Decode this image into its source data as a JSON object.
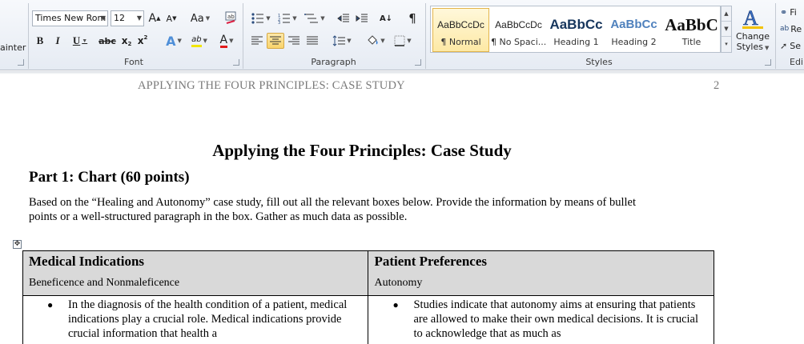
{
  "ribbon": {
    "clipboard": {
      "partial_label": "ainter"
    },
    "font": {
      "font_name": "Times New Rom",
      "font_size": "12",
      "grow_glyph": "A",
      "shrink_glyph": "A",
      "change_case_glyph": "Aa",
      "bold": "B",
      "italic": "I",
      "underline": "U",
      "strikethrough": "abc",
      "subscript": "x",
      "superscript": "x",
      "text_effects": "A",
      "highlight": "ab",
      "font_color": "A",
      "group_label": "Font"
    },
    "paragraph": {
      "show_marks": "¶",
      "sort": "A↓",
      "group_label": "Paragraph"
    },
    "styles": {
      "tiles": [
        {
          "sample": "AaBbCcDc",
          "name": "¶ Normal"
        },
        {
          "sample": "AaBbCcDc",
          "name": "¶ No Spaci..."
        },
        {
          "sample": "AaBbCc",
          "name": "Heading 1"
        },
        {
          "sample": "AaBbCc",
          "name": "Heading 2"
        },
        {
          "sample": "AaBbC",
          "name": "Title"
        }
      ],
      "change_styles_line1": "Change",
      "change_styles_line2": "Styles",
      "group_label": "Styles"
    },
    "editing": {
      "find": "Fi",
      "replace": "Re",
      "select": "Se",
      "group_label": "Edi"
    }
  },
  "document": {
    "header": "APPLYING THE FOUR PRINCIPLES: CASE STUDY",
    "page_number": "2",
    "title": "Applying the Four Principles: Case Study",
    "part_heading": "Part 1: Chart  (60 points)",
    "intro_line1": "Based on the “Healing and Autonomy” case study, fill out all the relevant boxes below. Provide the information by means of bullet",
    "intro_line2": "points or a well-structured paragraph in the box. Gather as much data as possible.",
    "table": {
      "col1_title": "Medical Indications",
      "col1_sub": "Beneficence and Nonmaleficence",
      "col2_title": "Patient Preferences",
      "col2_sub": "Autonomy",
      "col1_text": "In the diagnosis of the health condition of a patient, medical indications play a crucial role. Medical indications provide crucial information that health a",
      "col2_text": "Studies indicate that autonomy aims at ensuring that patients are allowed to make their own medical decisions. It is crucial to acknowledge that as much as"
    }
  }
}
